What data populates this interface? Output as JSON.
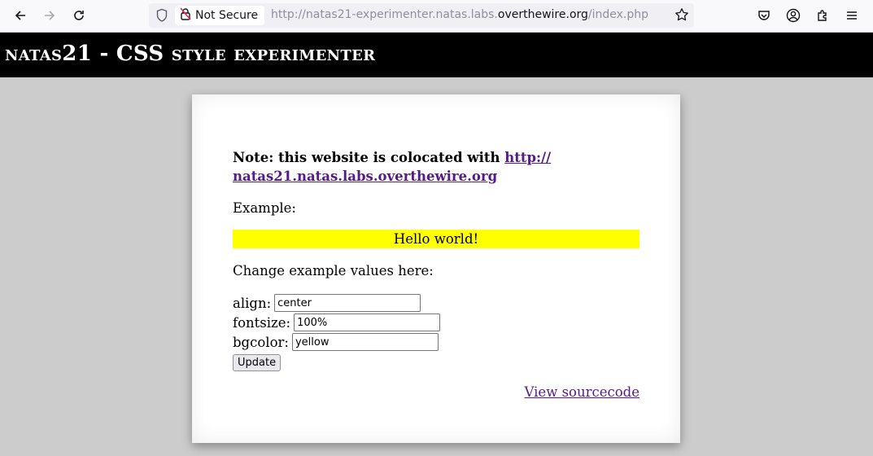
{
  "browser": {
    "security_label": "Not Secure",
    "url_prefix": "http://natas21-experimenter.natas.labs.",
    "url_host": "overthewire.org",
    "url_suffix": "/index.php"
  },
  "page": {
    "title": "natas21 - CSS style experimenter",
    "note_text": "Note: this website is colocated with ",
    "note_link_line1": "http://",
    "note_link_line2": "natas21.natas.labs.overthewire.org",
    "example_label": "Example:",
    "example_text": "Hello world!",
    "change_label": "Change example values here:",
    "form": {
      "align_label": "align:",
      "align_value": "center",
      "fontsize_label": "fontsize:",
      "fontsize_value": "100%",
      "bgcolor_label": "bgcolor:",
      "bgcolor_value": "yellow",
      "update_label": "Update"
    },
    "view_source_label": "View sourcecode"
  },
  "colors": {
    "header_bg": "#000000",
    "page_bg": "#cccccc",
    "example_bg": "#ffff00",
    "link": "#551a8b"
  }
}
